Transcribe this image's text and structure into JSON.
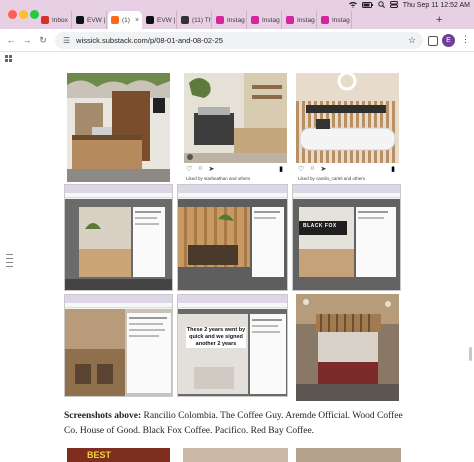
{
  "system": {
    "menu_icons": [
      "wifi-icon",
      "battery-icon",
      "search-icon",
      "control-center-icon"
    ],
    "clock": "Thu Sep 11  12:52 AM"
  },
  "tabs": [
    {
      "label": "Inbox",
      "favicon": "gmail-icon",
      "color": "#d93025"
    },
    {
      "label": "EVW |",
      "favicon": "x-icon",
      "color": "#111111"
    },
    {
      "label": "(1)",
      "favicon": "substack-icon",
      "color": "#ff6719",
      "active": true
    },
    {
      "label": "EVW |",
      "favicon": "x-icon",
      "color": "#111111"
    },
    {
      "label": "(11) Th",
      "favicon": "x-icon",
      "color": "#333333"
    },
    {
      "label": "Instag",
      "favicon": "instagram-icon",
      "color": "#d6249f"
    },
    {
      "label": "Instag",
      "favicon": "instagram-icon",
      "color": "#d6249f"
    },
    {
      "label": "Instag",
      "favicon": "instagram-icon",
      "color": "#d6249f"
    },
    {
      "label": "Instag",
      "favicon": "instagram-icon",
      "color": "#d6249f"
    }
  ],
  "toolbar": {
    "url": "wissick.substack.com/p/08-01-and-08-02-25",
    "profile_initial": "E"
  },
  "content": {
    "ig_likes_1": "Liked by starbeathan and others",
    "ig_likes_2": "Liked by camilo_cartel and others",
    "overlay_text": "These 2 years went by quick and we signed another 2 years",
    "brand_text": "BLACK FOX",
    "caption_bold": "Screenshots above:",
    "caption_text": " Rancilio Colombia. The Coffee Guy. Aremde Official. Wood Coffee Co. House of Good. Black Fox Coffee. Pacifico. Red Bay Coffee.",
    "partial_sign": "BEST"
  }
}
